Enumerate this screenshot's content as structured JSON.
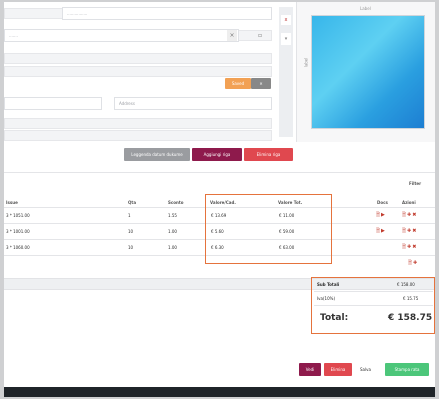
{
  "form": {
    "field1_placeholder": "................",
    "field2_placeholder": ".......",
    "save_small_label": "Saved",
    "field3_placeholder": "Address"
  },
  "image_panel": {
    "label": "Label",
    "side_label": "label"
  },
  "actions": {
    "btn_gray": "Leggenda datum dukume",
    "btn_purple": "Aggiungi riga",
    "btn_red": "Elimina riga"
  },
  "table": {
    "filter_label": "Filter",
    "headers": [
      "Issue",
      "Qta",
      "Sconto",
      "Valore/Cad.",
      "Valore Tot.",
      "Docs",
      "Azioni"
    ],
    "rows": [
      {
        "item": "3 * 1051.00",
        "qty": "1",
        "disc": "1.55",
        "unit": "€ 13.69",
        "total": "€ 11.00"
      },
      {
        "item": "3 * 1001.00",
        "qty": "10",
        "disc": "1.00",
        "unit": "€ 5.60",
        "total": "€ 59.00"
      },
      {
        "item": "3 * 1060.00",
        "qty": "10",
        "disc": "1.00",
        "unit": "€ 6.30",
        "total": "€ 63.00"
      }
    ]
  },
  "totals": {
    "subtotal_label": "Sub Totali",
    "subtotal_value": "€ 158.00",
    "vat_label": "Iva(10%)",
    "vat_value": "€ 15.75",
    "total_label": "Total:",
    "total_value": "€ 158.75"
  },
  "footer": {
    "btn_purple": "Vedi",
    "btn_red": "Elimina",
    "text": "Salva",
    "btn_green": "Stampa rata"
  },
  "colors": {
    "highlight": "#e5733d",
    "purple": "#8e1a4c",
    "red": "#e0484f",
    "green": "#4cc67a",
    "orange": "#f2a154"
  }
}
